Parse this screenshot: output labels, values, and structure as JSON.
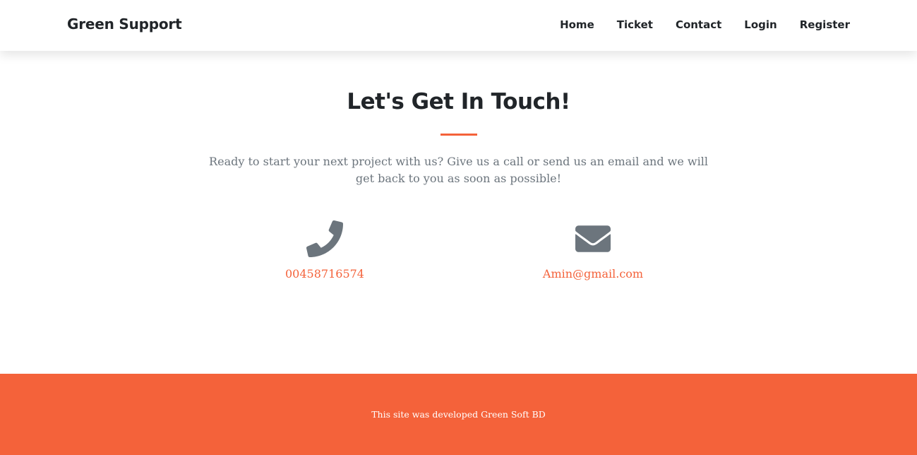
{
  "navbar": {
    "brand": "Green Support",
    "links": [
      "Home",
      "Ticket",
      "Contact",
      "Login",
      "Register"
    ]
  },
  "contact": {
    "heading": "Let's Get In Touch!",
    "lead": "Ready to start your next project with us? Give us a call or send us an email and we will get back to you as soon as possible!",
    "phone": {
      "icon": "phone-icon",
      "value": "00458716574"
    },
    "email": {
      "icon": "envelope-icon",
      "value": "Amin@gmail.com"
    }
  },
  "footer": {
    "text": "This site was developed Green Soft BD"
  },
  "colors": {
    "accent": "#f4623a",
    "icon": "#6c757d",
    "text": "#212529",
    "muted": "#6c757d"
  }
}
